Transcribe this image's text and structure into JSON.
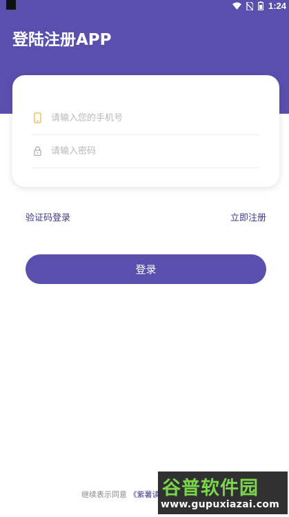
{
  "status_bar": {
    "time": "1:24",
    "icons": [
      "wifi-icon",
      "no-sim-icon",
      "battery-icon"
    ]
  },
  "app": {
    "title": "登陆注册APP"
  },
  "form": {
    "phone_placeholder": "请输入您的手机号",
    "password_placeholder": "请输入密码"
  },
  "links": {
    "sms_login": "验证码登录",
    "register": "立即注册"
  },
  "login_button": "登录",
  "footer": {
    "text": "继续表示同意",
    "policy": "《紫薯读"
  },
  "watermark": {
    "title": "谷普软件园",
    "url": "www.gupuxiazai.com"
  },
  "colors": {
    "primary": "#5b4fae",
    "link": "#3c3a86",
    "watermark_green": "#6fd33d"
  }
}
